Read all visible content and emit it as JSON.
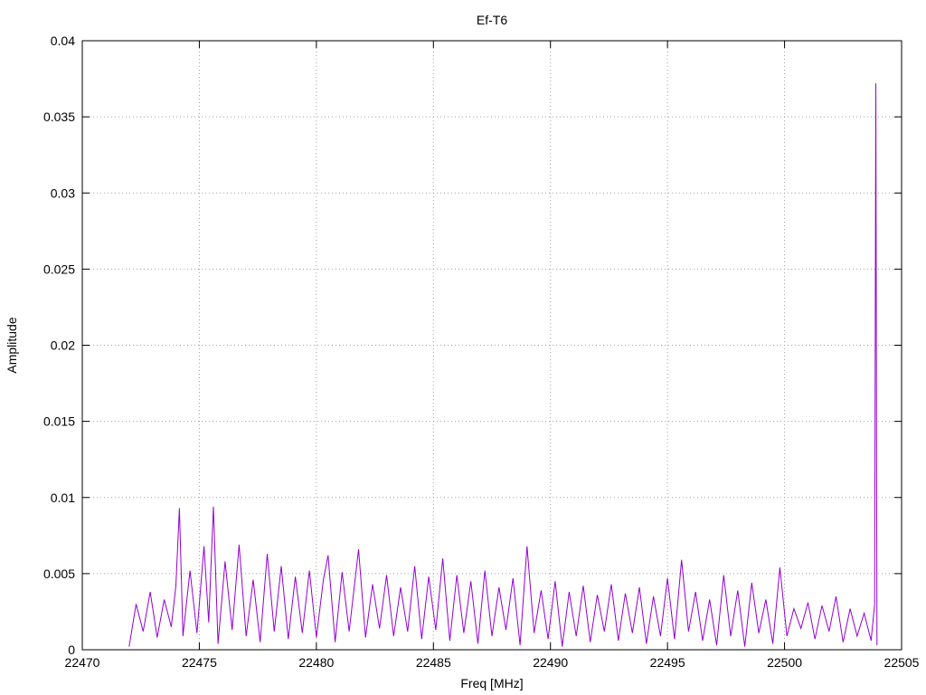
{
  "chart_data": {
    "type": "line",
    "title": "Ef-T6",
    "xlabel": "Freq [MHz]",
    "ylabel": "Amplitude",
    "xlim": [
      22470,
      22505
    ],
    "ylim": [
      0,
      0.04
    ],
    "xticks": [
      22470,
      22475,
      22480,
      22485,
      22490,
      22495,
      22500,
      22505
    ],
    "yticks": [
      0,
      0.005,
      0.01,
      0.015,
      0.02,
      0.025,
      0.03,
      0.035,
      0.04
    ],
    "grid": true,
    "line_color": "#9400d3",
    "series": [
      {
        "x": [
          22472.0,
          22472.3,
          22472.6,
          22472.9,
          22473.2,
          22473.5,
          22473.8,
          22474.0,
          22474.15,
          22474.3,
          22474.6,
          22474.9,
          22475.2,
          22475.4,
          22475.6,
          22475.8,
          22476.1,
          22476.4,
          22476.7,
          22477.0,
          22477.3,
          22477.6,
          22477.9,
          22478.2,
          22478.5,
          22478.8,
          22479.1,
          22479.4,
          22479.7,
          22480.0,
          22480.3,
          22480.5,
          22480.8,
          22481.1,
          22481.4,
          22481.8,
          22482.1,
          22482.4,
          22482.7,
          22483.0,
          22483.3,
          22483.6,
          22483.9,
          22484.2,
          22484.5,
          22484.8,
          22485.1,
          22485.4,
          22485.7,
          22486.0,
          22486.3,
          22486.6,
          22486.9,
          22487.2,
          22487.5,
          22487.8,
          22488.1,
          22488.4,
          22488.7,
          22489.0,
          22489.3,
          22489.6,
          22489.9,
          22490.2,
          22490.5,
          22490.8,
          22491.1,
          22491.4,
          22491.7,
          22492.0,
          22492.3,
          22492.6,
          22492.9,
          22493.2,
          22493.5,
          22493.8,
          22494.1,
          22494.4,
          22494.7,
          22495.0,
          22495.3,
          22495.6,
          22495.9,
          22496.2,
          22496.5,
          22496.8,
          22497.1,
          22497.4,
          22497.7,
          22498.0,
          22498.3,
          22498.6,
          22498.9,
          22499.2,
          22499.5,
          22499.8,
          22500.1,
          22500.4,
          22500.7,
          22501.0,
          22501.3,
          22501.6,
          22501.9,
          22502.2,
          22502.5,
          22502.8,
          22503.1,
          22503.4,
          22503.7,
          22503.85,
          22503.9,
          22503.95
        ],
        "y": [
          0.0002,
          0.003,
          0.0012,
          0.0038,
          0.0008,
          0.0033,
          0.0015,
          0.0042,
          0.0093,
          0.0009,
          0.0052,
          0.0011,
          0.0068,
          0.0018,
          0.0094,
          0.0004,
          0.0058,
          0.0013,
          0.0069,
          0.0009,
          0.0046,
          0.0005,
          0.0063,
          0.0012,
          0.0055,
          0.0007,
          0.0048,
          0.0011,
          0.0052,
          0.0008,
          0.0046,
          0.0062,
          0.0005,
          0.0051,
          0.0012,
          0.0066,
          0.0008,
          0.0043,
          0.0014,
          0.0049,
          0.0009,
          0.0041,
          0.0012,
          0.0055,
          0.0007,
          0.0048,
          0.0013,
          0.006,
          0.0006,
          0.0049,
          0.0011,
          0.0045,
          0.0004,
          0.0052,
          0.0009,
          0.0041,
          0.0013,
          0.0047,
          0.0003,
          0.0068,
          0.0011,
          0.0039,
          0.0007,
          0.0045,
          0.0002,
          0.0038,
          0.0009,
          0.0042,
          0.0005,
          0.0036,
          0.0012,
          0.0043,
          0.0006,
          0.0037,
          0.0011,
          0.0041,
          0.0004,
          0.0035,
          0.0009,
          0.0047,
          0.0007,
          0.0059,
          0.0012,
          0.0038,
          0.0006,
          0.0033,
          0.0003,
          0.0049,
          0.0009,
          0.0039,
          0.0002,
          0.0044,
          0.0011,
          0.0033,
          0.0004,
          0.0054,
          0.0009,
          0.0027,
          0.0014,
          0.0031,
          0.0007,
          0.0029,
          0.0012,
          0.0035,
          0.0005,
          0.0027,
          0.0009,
          0.0024,
          0.0006,
          0.003,
          0.0372,
          0.0003
        ]
      }
    ]
  }
}
